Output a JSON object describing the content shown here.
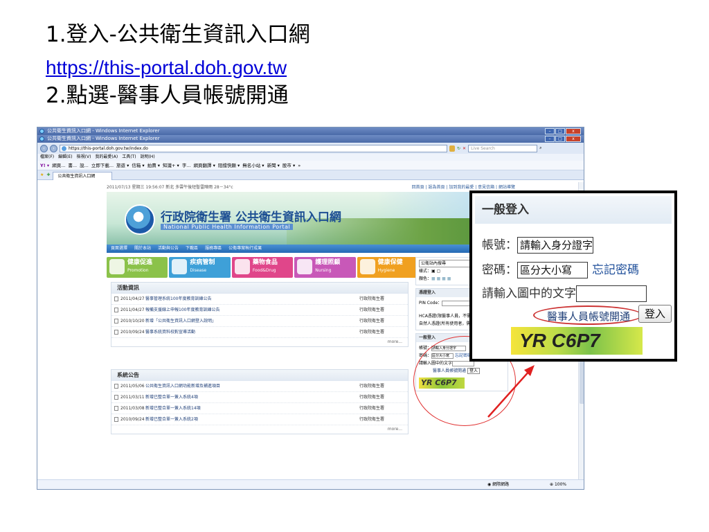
{
  "slide": {
    "title": "1.登入-公共衛生資訊入口網",
    "link": "https://this-portal.doh.gov.tw",
    "subtitle": "2.點選-醫事人員帳號開通"
  },
  "browser": {
    "window_title": "公共衛生資訊入口網 - Windows Internet Explorer",
    "window_title_2": "公共衛生資訊入口網 - Windows Internet Explorer",
    "url": "https://this-portal.doh.gov.tw/index.do",
    "search_placeholder": "Live Search",
    "menu": [
      "檔案(F)",
      "編輯(E)",
      "檢視(V)",
      "我的最愛(A)",
      "工具(T)",
      "說明(H)"
    ],
    "links": [
      "Y! ▾",
      "網頁...",
      "書...",
      "設...",
      "立即下載...",
      "旅遊 ▾",
      "信箱 ▾",
      "拍賣 ▾",
      "知識+ ▾",
      "字...",
      "網頁翻譯 ▾",
      "阻擋快顯 ▾",
      "無名小站 ▾",
      "新聞 ▾",
      "股市 ▾",
      "»"
    ],
    "tab_label": "公共衛生資訊入口網",
    "status_network": "網際網路",
    "status_zoom": "100%"
  },
  "site": {
    "date_line": "2011/07/13 星期三 19:56:07   新北 多雲午後短暫雷陣雨 28－34°c",
    "top_links": "回首頁 | 設為首頁 | 加到我的最愛 | 意見信箱 | 網站導覽",
    "title": "行政院衛生署 公共衛生資訊入口網",
    "subtitle": "National Public Health Information Portal",
    "nav": [
      "頁面選擇",
      "關於本站",
      "活動與公告",
      "下載區",
      "服務專區",
      "公衛專案執行成果"
    ],
    "tiles": [
      {
        "label": "健康促進",
        "en": "Promotion"
      },
      {
        "label": "疾病管制",
        "en": "Disease"
      },
      {
        "label": "藥物食品",
        "en": "Food&Drug"
      },
      {
        "label": "護理照顧",
        "en": "Nursing"
      },
      {
        "label": "健康保健",
        "en": "Hygiene"
      }
    ],
    "activities": {
      "heading": "活動資訊",
      "rows": [
        {
          "date": "2011/04/27",
          "title": "醫事管理系統100年度教育訓練公告",
          "source": "行政院衛生署"
        },
        {
          "date": "2011/04/27",
          "title": "報備支援線上申報100年度教育訓練公告",
          "source": "行政院衛生署"
        },
        {
          "date": "2010/10/20",
          "title": "新增「公共衛生資訊入口網登入說明」",
          "source": "行政院衛生署"
        },
        {
          "date": "2010/09/24",
          "title": "醫事系統資料校對宣導活動",
          "source": "行政院衛生署"
        }
      ],
      "more": "more..."
    },
    "announcements": {
      "heading": "系統公告",
      "rows": [
        {
          "date": "2011/05/06",
          "title": "公共衛生資訊入口網功能新增及補進項目",
          "source": "行政院衛生署"
        },
        {
          "date": "2011/03/11",
          "title": "新增已整合單一簽入系統4項",
          "source": "行政院衛生署"
        },
        {
          "date": "2011/03/08",
          "title": "新增已整合單一簽入系統14項",
          "source": "行政院衛生署"
        },
        {
          "date": "2010/09/24",
          "title": "新增已整合單一簽入系統2項",
          "source": "行政院衛生署"
        }
      ],
      "more": "more..."
    },
    "right": {
      "search_box": "公衛站內搜尋",
      "style_label": "樣式：",
      "color_label": "顏色：",
      "cert_heading": "憑證登入",
      "pin_label": "PIN Code：",
      "hca_text": "HCA憑證(限醫事人員，不需註冊)",
      "moica_text": "自然人憑證(所有使用者，需先註冊)",
      "login_heading": "一般登入",
      "account_label": "帳號：",
      "account_value": "請輸入身分證字",
      "password_label": "密碼：",
      "password_value": "區分大小寫",
      "forgot": "忘記密碼",
      "captcha_label": "請輸入圖中的文字",
      "activate": "醫事人員帳號開通",
      "login_button": "登入",
      "captcha": "YR C6P7"
    }
  },
  "zoom": {
    "heading": "一般登入",
    "account_label": "帳號：",
    "account_value": "請輸入身分證字",
    "password_label": "密碼：",
    "password_value": "區分大小寫",
    "forgot": "忘記密碼",
    "captcha_label": "請輸入圖中的文字",
    "activate": "醫事人員帳號開通",
    "login_button": "登入",
    "captcha": "YR C6P7"
  },
  "colors": {
    "link": "#0000d8",
    "highlight": "#e03030",
    "nav": "#2469b4"
  }
}
